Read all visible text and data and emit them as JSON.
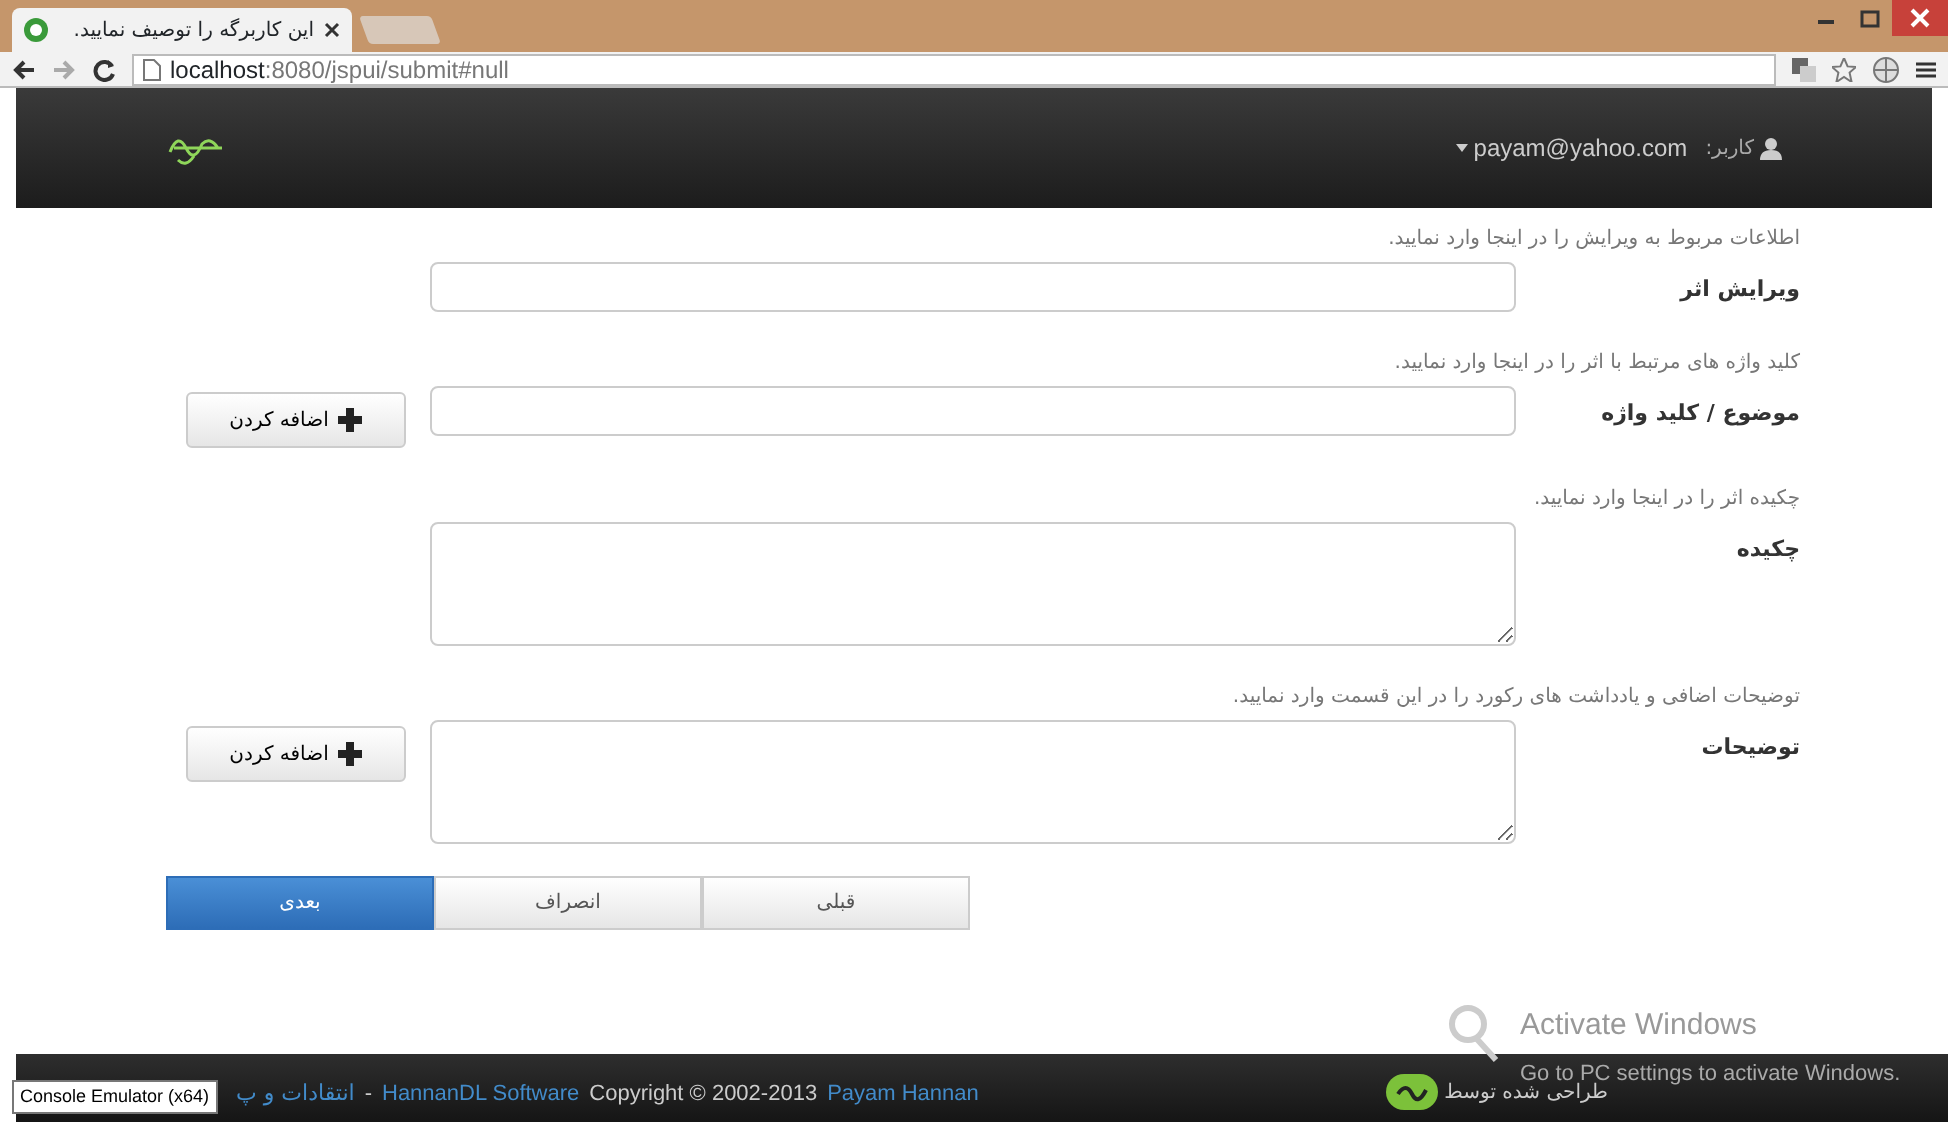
{
  "browser": {
    "tab_title": "این کاربرگه را توصیف نمایید.",
    "address_host": "localhost",
    "address_rest": ":8080/jspui/submit#null"
  },
  "navbar": {
    "user_label": "کاربر:",
    "user": "payam@yahoo.com"
  },
  "fields": [
    {
      "hint": "اطلاعات مربوط به ویرایش را در اینجا وارد نمایید.",
      "label": "ویرایش اثر",
      "kind": "input"
    },
    {
      "hint": "کلید واژه های مرتبط با اثر را در اینجا وارد نمایید.",
      "label": "موضوع / کلید واژه",
      "kind": "input",
      "add_button": "اضافه کردن"
    },
    {
      "hint": "چکیده اثر را در اینجا وارد نمایید.",
      "label": "چکیده",
      "kind": "textarea"
    },
    {
      "hint": "توضیحات اضافی و یادداشت های رکورد را در این قسمت وارد نمایید.",
      "label": "توضیحات",
      "kind": "textarea",
      "add_button": "اضافه کردن"
    }
  ],
  "nav_buttons": [
    {
      "label": "قبلی",
      "selected": false
    },
    {
      "label": "انصراف",
      "selected": false
    },
    {
      "label": "بعدی",
      "selected": true
    }
  ],
  "os_overlay": {
    "title": "Activate Windows",
    "subtitle": "Go to PC settings to activate Windows."
  },
  "footer": {
    "feedback_link": "انتقادات و پ",
    "separator": "-",
    "software_link": "HannanDL Software",
    "copyright": "Copyright © 2002-2013",
    "author_link": "Payam Hannan",
    "designed_by": "طراحی شده توسط"
  },
  "tooltip": "Console Emulator (x64)"
}
